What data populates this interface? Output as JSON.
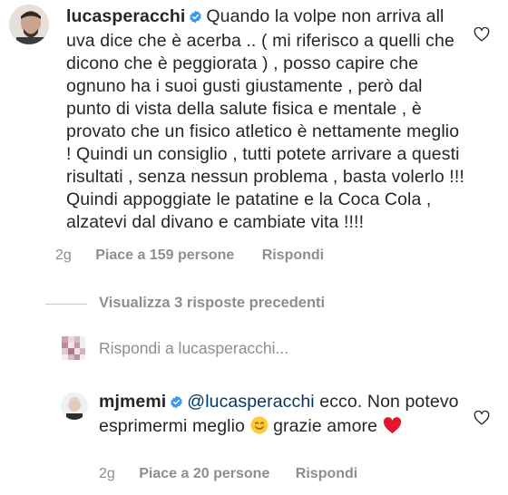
{
  "comment1": {
    "username": "lucasperacchi",
    "text": "Quando la volpe non arriva all uva dice che è acerba .. ( mi riferisco a quelli che dicono che è peggiorata ) , posso capire che ognuno ha i suoi gusti giustamente , però dal punto di vista della salute fisica e mentale , è provato che un fisico atletico è nettamente meglio ! Quindi un consiglio , tutti potete arrivare a questi risultati , senza nessun problema , basta volerlo !!! Quindi appoggiate le patatine e la Coca Cola , alzatevi dal divano e cambiate vita !!!!",
    "time": "2g",
    "likes": "Piace a 159 persone",
    "reply": "Rispondi"
  },
  "view_replies": "Visualizza 3 risposte precedenti",
  "reply_bar": "Rispondi a lucasperacchi...",
  "comment2": {
    "username": "mjmemi",
    "mention": "@lucasperacchi",
    "text_a": "ecco. Non potevo esprimermi meglio",
    "text_b": "grazie amore",
    "time": "2g",
    "likes": "Piace a 20 persone",
    "reply": "Rispondi"
  },
  "icons": {
    "verified": "verified-badge-icon",
    "like": "heart-outline-icon",
    "smile_emoji": "smiling-face-emoji",
    "heart_emoji": "red-heart-emoji"
  },
  "colors": {
    "verified_blue": "#3897f0",
    "meta_gray": "#8e8e8e",
    "mention_blue": "#00376b",
    "heart_red": "#e4152f"
  }
}
